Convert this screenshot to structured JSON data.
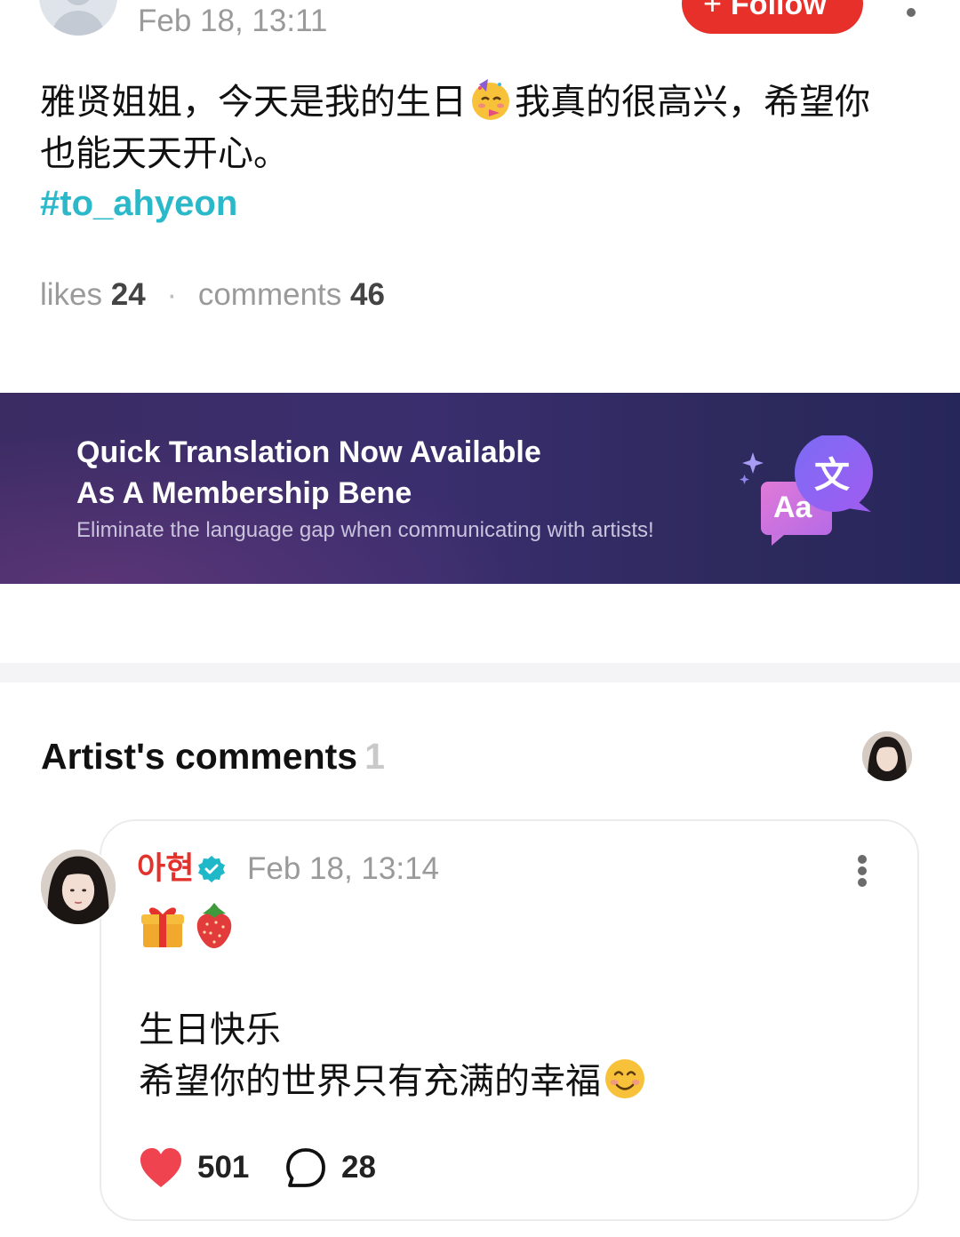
{
  "post": {
    "timestamp": "Feb 18, 13:11",
    "follow_label": "Follow",
    "follow_icon": "plus-icon",
    "text_line1_before_emoji": "雅贤姐姐，今天是我的生日",
    "text_line1_after_emoji": "我真的很高兴，希望你",
    "text_line2": "也能天天开心。",
    "inline_emoji": "partying-face-icon",
    "hashtag": "#to_ahyeon",
    "likes_label": "likes",
    "likes_count": "24",
    "separator": "·",
    "comments_label": "comments",
    "comments_count": "46"
  },
  "banner": {
    "title_line1": "Quick Translation Now Available",
    "title_line2": "As A Membership Bene",
    "subtitle": "Eliminate the language gap when communicating with artists!",
    "art_glyph_main": "文",
    "art_glyph_secondary": "Aa"
  },
  "artist_comments": {
    "heading": "Artist's comments",
    "count": "1",
    "comment": {
      "author": "아현",
      "verified": true,
      "timestamp": "Feb 18, 13:14",
      "emojis": [
        "gift-icon",
        "strawberry-icon"
      ],
      "text_line1": "生日快乐",
      "text_line2": "希望你的世界只有充满的幸福",
      "trailing_emoji": "smiling-face-icon",
      "likes": "501",
      "replies": "28"
    }
  },
  "colors": {
    "follow_red": "#e8302a",
    "hashtag_teal": "#2bb9c9",
    "artist_name_red": "#e3322c",
    "heart_red": "#ef4450",
    "banner_purple": "#3a2e6e",
    "verified_teal": "#1fb8c9"
  }
}
